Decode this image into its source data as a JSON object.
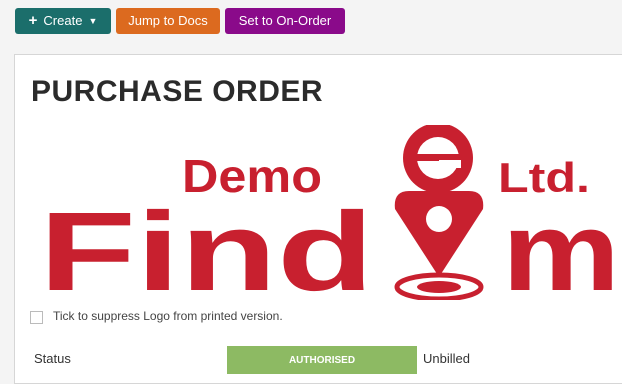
{
  "toolbar": {
    "create_label": "Create",
    "jump_label": "Jump to Docs",
    "onorder_label": "Set to On-Order",
    "colors": {
      "create": "#1b6e6b",
      "docs": "#dc6a1f",
      "onorder": "#8a0a8a"
    }
  },
  "document": {
    "title": "PURCHASE ORDER",
    "logo": {
      "word_main": "Find",
      "word_end": "m",
      "word_demo": "Demo",
      "word_ltd": "Ltd.",
      "color": "#c8202f"
    },
    "suppress_label": "Tick to suppress Logo from printed version.",
    "suppress_checked": false,
    "status_label": "Status",
    "status_value": "AUTHORISED",
    "billing_value": "Unbilled"
  }
}
